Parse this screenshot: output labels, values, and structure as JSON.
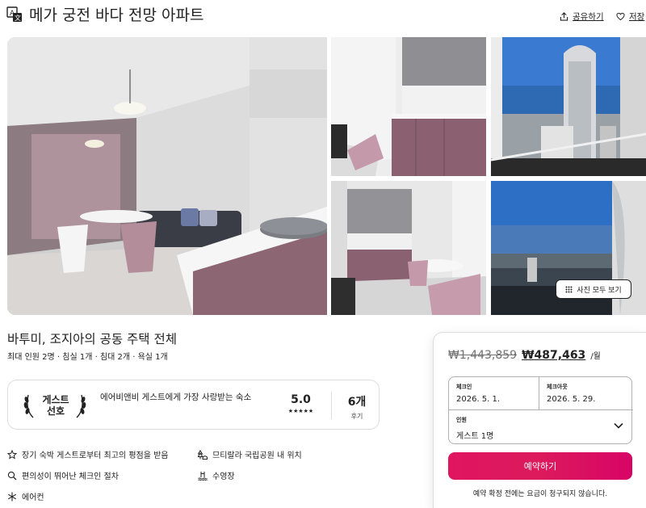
{
  "header": {
    "title": "메가 궁전 바다 전망 아파트",
    "share_label": "공유하기",
    "save_label": "저장"
  },
  "gallery": {
    "show_all_label": "사진 모두 보기",
    "photos": [
      "living-room",
      "kitchen",
      "tower-view",
      "kitchen-dining",
      "sea-view"
    ]
  },
  "listing": {
    "subtitle": "바투미, 조지아의 공동 주택 전체",
    "meta": "최대 인원 2명 · 침실 1개 · 침대 2개 · 욕실 1개"
  },
  "guest_favorite": {
    "badge_line1": "게스트",
    "badge_line2": "선호",
    "description": "에어비앤비 게스트에게 가장 사랑받는 숙소",
    "rating": "5.0",
    "stars": "★★★★★",
    "reviews_count": "6개",
    "reviews_label": "후기"
  },
  "amenities": [
    {
      "icon": "star-outline-icon",
      "label": "장기 숙박 게스트로부터 최고의 평점을 받음"
    },
    {
      "icon": "park-icon",
      "label": "므티랄라 국립공원 내 위치"
    },
    {
      "icon": "key-search-icon",
      "label": "편의성이 뛰어난 체크인 절차"
    },
    {
      "icon": "pool-icon",
      "label": "수영장"
    },
    {
      "icon": "snowflake-icon",
      "label": "에어컨"
    }
  ],
  "booking": {
    "price_old": "₩1,443,859",
    "price_new": "₩487,463",
    "price_unit": "/월",
    "checkin_label": "체크인",
    "checkin_value": "2026. 5. 1.",
    "checkout_label": "체크아웃",
    "checkout_value": "2026. 5. 29.",
    "guests_label": "인원",
    "guests_value": "게스트 1명",
    "reserve_label": "예약하기",
    "note": "예약 확정 전에는 요금이 청구되지 않습니다."
  },
  "colors": {
    "brand": "#e01560",
    "text": "#222222",
    "muted": "#717171",
    "border": "#dddddd"
  }
}
